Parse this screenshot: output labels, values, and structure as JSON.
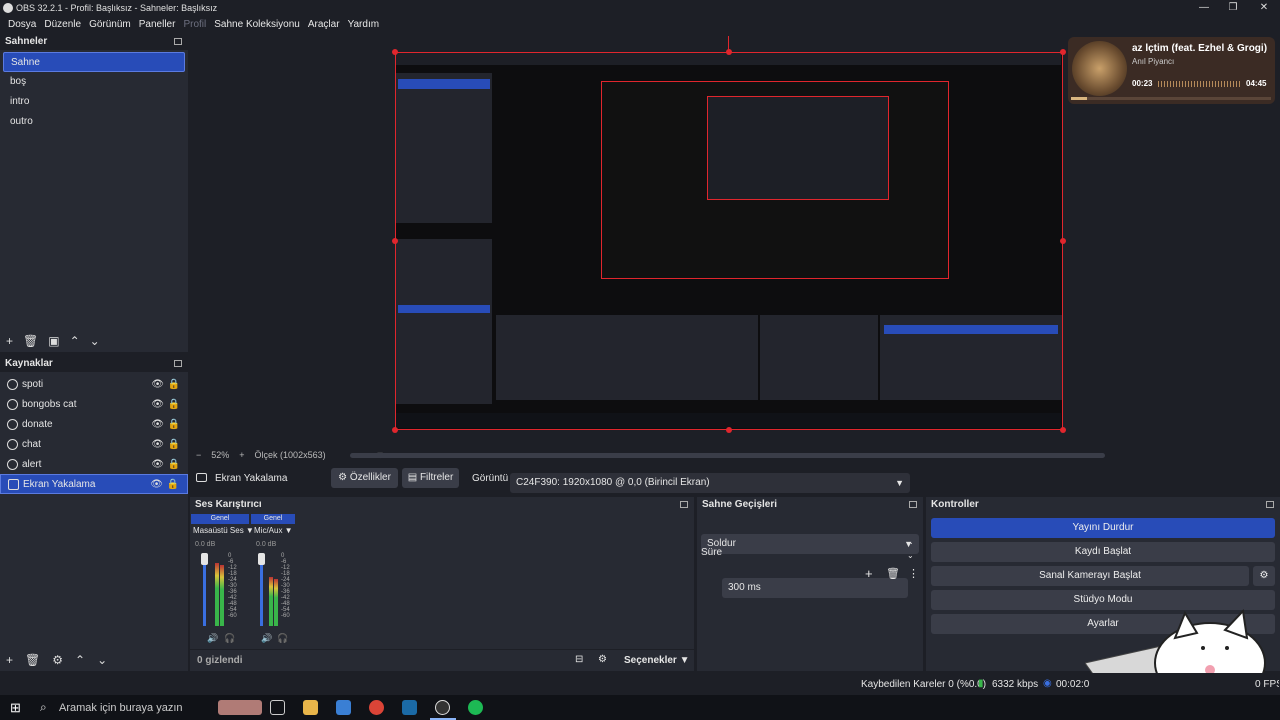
{
  "window": {
    "title": "OBS 32.2.1 - Profil: Başlıksız - Sahneler: Başlıksız"
  },
  "menu": [
    "Dosya",
    "Düzenle",
    "Görünüm",
    "Paneller",
    "Profil",
    "Sahne Koleksiyonu",
    "Araçlar",
    "Yardım"
  ],
  "scenes": {
    "title": "Sahneler",
    "items": [
      "Sahne",
      "boş",
      "intro",
      "outro"
    ],
    "selected": 0
  },
  "sources": {
    "title": "Kaynaklar",
    "items": [
      "spoti",
      "bongobs cat",
      "donate",
      "chat",
      "alert",
      "Ekran Yakalama"
    ],
    "selected": 5
  },
  "preview": {
    "zoom": "52%",
    "scale_label": "Ölçek (1002x563)"
  },
  "source_toolbar": {
    "source_name": "Ekran Yakalama",
    "properties": "Özellikler",
    "filters": "Filtreler",
    "display_label": "Görüntü",
    "display_value": "C24F390: 1920x1080 @ 0,0 (Birincil Ekran)"
  },
  "mixer": {
    "title": "Ses Karıştırıcı",
    "channels": [
      {
        "tag": "Genel",
        "name": "Masaüstü Ses",
        "db": "0.0 dB"
      },
      {
        "tag": "Genel",
        "name": "Mic/Aux",
        "db": "0.0 dB"
      }
    ],
    "scale": [
      "0",
      "-6",
      "-12",
      "-18",
      "-24",
      "-30",
      "-36",
      "-42",
      "-48",
      "-54",
      "-60"
    ],
    "hidden": "0 gizlendi",
    "options": "Seçenekler"
  },
  "transitions": {
    "title": "Sahne Geçişleri",
    "type": "Soldur",
    "duration_label": "Süre",
    "duration": "300 ms"
  },
  "controls": {
    "title": "Kontroller",
    "buttons": [
      "Yayını Durdur",
      "Kaydı Başlat",
      "Sanal Kamerayı Başlat",
      "Stüdyo Modu",
      "Ayarlar"
    ]
  },
  "status": {
    "dropped": "Kaybedilen Kareler 0 (%0.0)",
    "bitrate": "6332 kbps",
    "time": "00:02:0",
    "fps": "0 FPS"
  },
  "music": {
    "title": "Yaz İçtim (feat. Ezhel & Grogi)",
    "title_visible": "az İçtim (feat. Ezhel & Grogi)",
    "artist": "Anıl Piyancı",
    "elapsed": "00:23",
    "total": "04:45",
    "progress": 0.08
  },
  "taskbar": {
    "search_placeholder": "Aramak için buraya yazın"
  },
  "colors": {
    "accent": "#284cb8",
    "record_red": "#e0262d",
    "bg": "#1d1f26",
    "panel": "#272a33"
  }
}
